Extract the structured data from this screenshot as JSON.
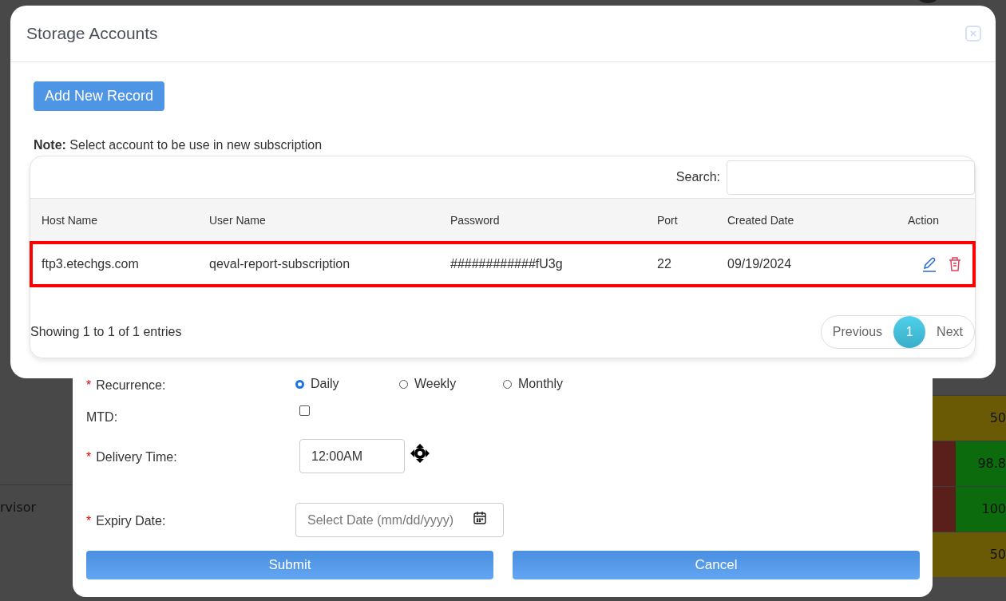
{
  "background": {
    "left_cells": [
      {
        "text": "rvisor"
      }
    ],
    "right_cells": [
      {
        "text": "50",
        "kind": "olive"
      },
      {
        "text": "98.8",
        "kind": "split"
      },
      {
        "text": "100",
        "kind": "split"
      },
      {
        "text": "50",
        "kind": "olive"
      }
    ]
  },
  "form": {
    "rows": [
      {
        "kind": "radios",
        "label": "Recurrence:",
        "required_mark": "*",
        "options": [
          {
            "label": "Daily",
            "selected": true
          },
          {
            "label": "Weekly",
            "selected": false
          },
          {
            "label": "Monthly",
            "selected": false
          }
        ]
      },
      {
        "kind": "checkbox",
        "label": "MTD:",
        "checked": false
      },
      {
        "kind": "time",
        "label": "Delivery Time:",
        "required_mark": "*",
        "value": "12:00AM"
      },
      {
        "kind": "date",
        "label": "Expiry Date:",
        "required_mark": "*",
        "placeholder": "Select Date (mm/dd/yyyy)"
      }
    ],
    "buttons": [
      {
        "label": "Submit"
      },
      {
        "label": "Cancel"
      }
    ]
  },
  "modal": {
    "title": "Storage Accounts",
    "add_button": "Add New Record",
    "note_label": "Note:",
    "note_text": "Select account to be use in new subscription",
    "search_label": "Search:",
    "table": {
      "columns": [
        "Host Name",
        "User Name",
        "Password",
        "Port",
        "Created Date",
        "Action"
      ],
      "rows": [
        {
          "cells": [
            "ftp3.etechgs.com",
            "qeval-report-subscription",
            "############fU3g",
            "22",
            "09/19/2024"
          ],
          "highlighted": true
        }
      ]
    },
    "info": "Showing 1 to 1 of 1 entries",
    "pagination": {
      "previous": "Previous",
      "pages": [
        {
          "label": "1",
          "selected": true
        }
      ],
      "next": "Next"
    }
  }
}
